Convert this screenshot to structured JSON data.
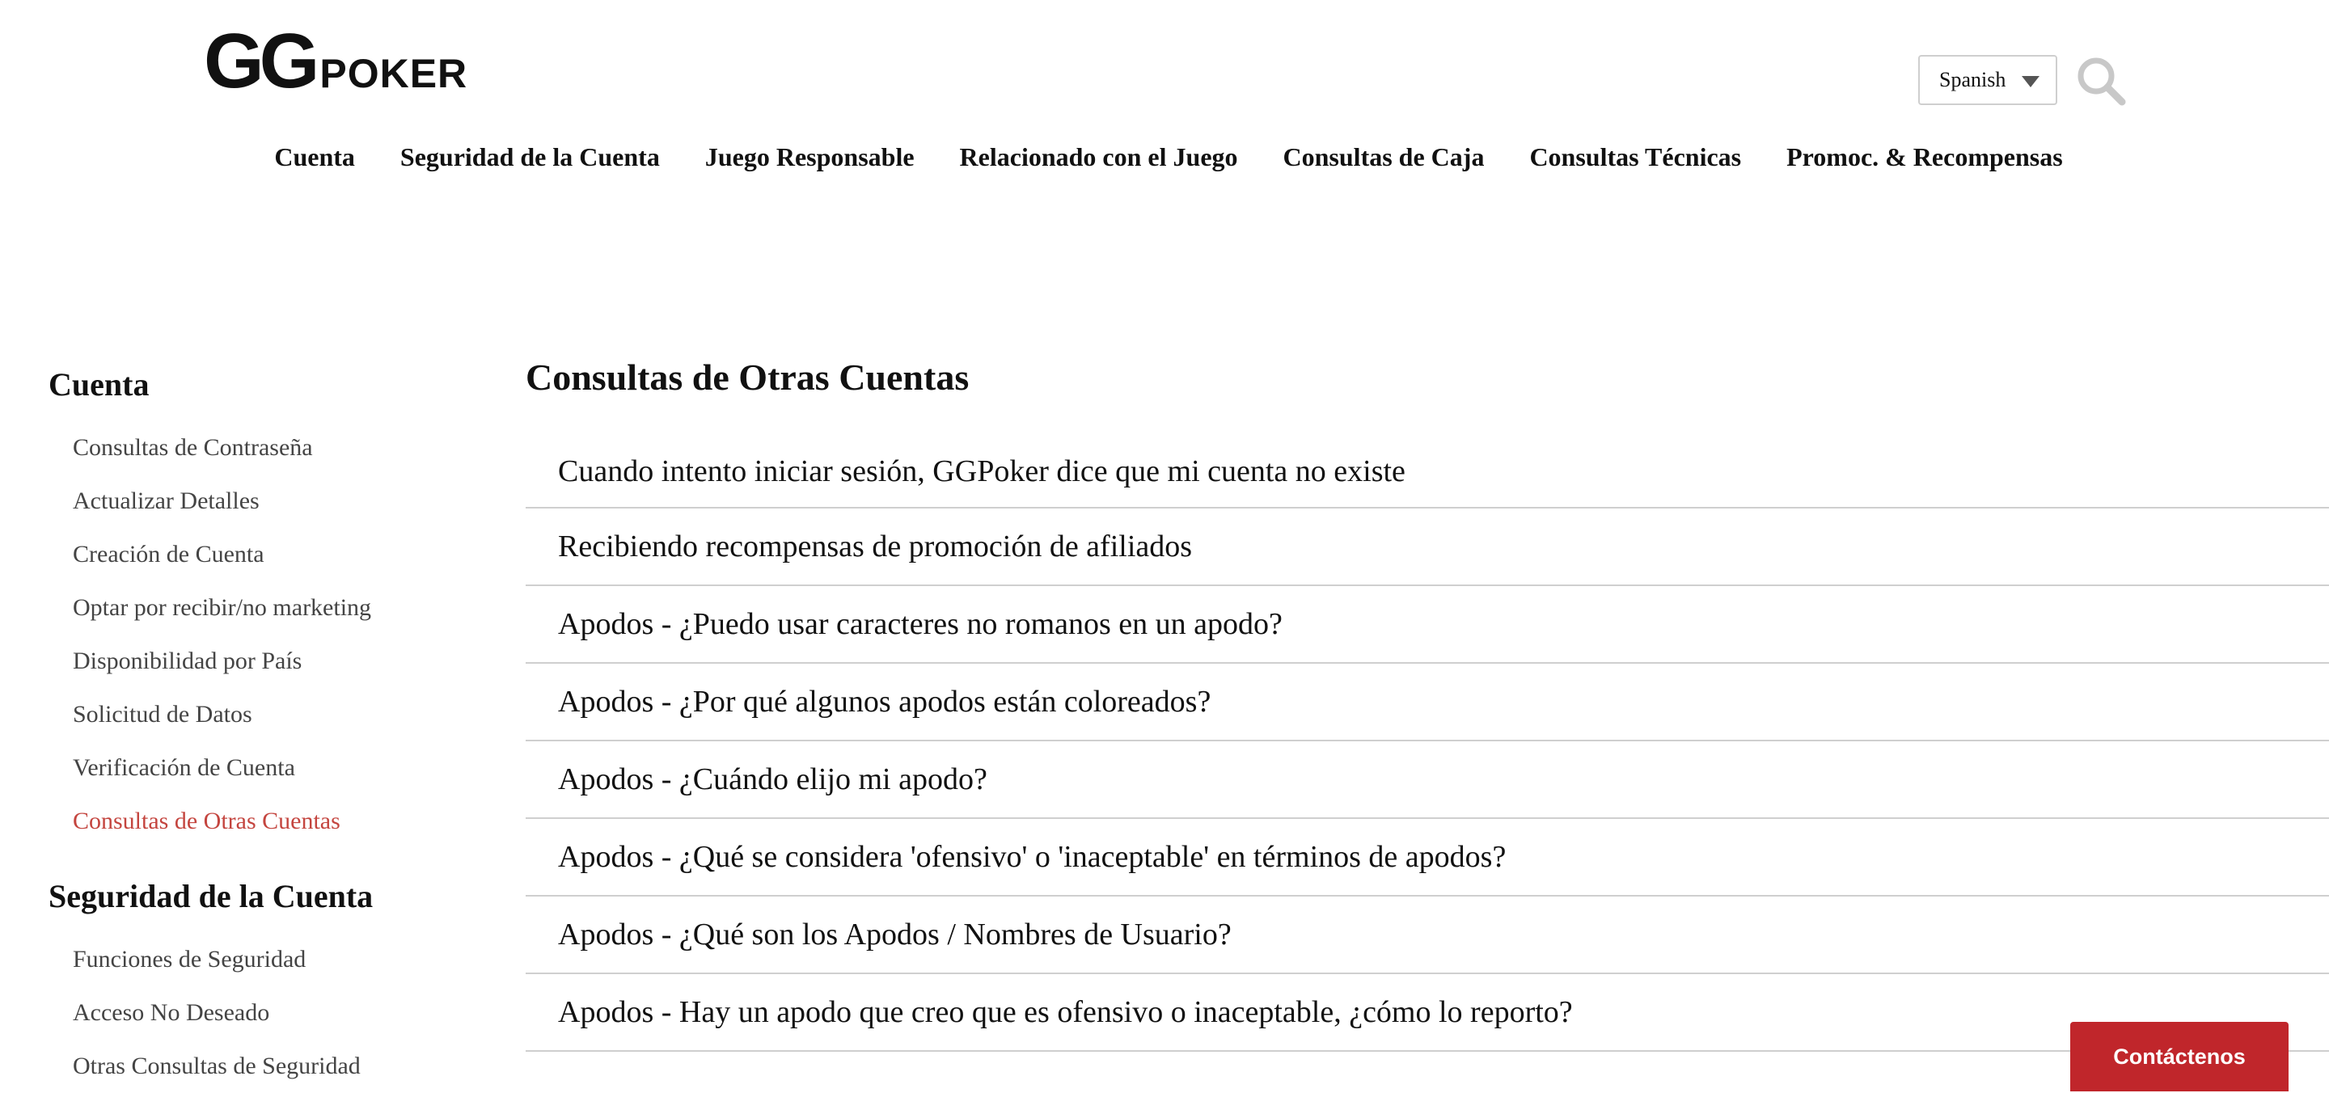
{
  "header": {
    "logo": {
      "mark": "GG",
      "wordmark": "POKER"
    },
    "language": {
      "selected": "Spanish"
    },
    "icons": {
      "search": "search-icon",
      "dropdown": "chevron-down-icon"
    },
    "colors": {
      "brand_red": "#c4262b",
      "active_link": "#c4453f",
      "contact_bg": "#c0262b"
    }
  },
  "nav": {
    "items": [
      {
        "label": "Cuenta"
      },
      {
        "label": "Seguridad de la Cuenta"
      },
      {
        "label": "Juego Responsable"
      },
      {
        "label": "Relacionado con el Juego"
      },
      {
        "label": "Consultas de Caja"
      },
      {
        "label": "Consultas Técnicas"
      },
      {
        "label": "Promoc. & Recompensas"
      }
    ]
  },
  "sidebar": {
    "sections": [
      {
        "title": "Cuenta",
        "items": [
          {
            "label": "Consultas de Contraseña"
          },
          {
            "label": "Actualizar Detalles"
          },
          {
            "label": "Creación de Cuenta"
          },
          {
            "label": "Optar por recibir/no marketing"
          },
          {
            "label": "Disponibilidad por País"
          },
          {
            "label": "Solicitud de Datos"
          },
          {
            "label": "Verificación de Cuenta"
          },
          {
            "label": "Consultas de Otras Cuentas"
          }
        ]
      },
      {
        "title": "Seguridad de la Cuenta",
        "items": [
          {
            "label": "Funciones de Seguridad"
          },
          {
            "label": "Acceso No Deseado"
          },
          {
            "label": "Otras Consultas de Seguridad"
          }
        ]
      }
    ]
  },
  "main": {
    "title": "Consultas de Otras Cuentas",
    "articles": [
      {
        "title": "Cuando intento iniciar sesión, GGPoker dice que mi cuenta no existe"
      },
      {
        "title": "Recibiendo recompensas de promoción de afiliados"
      },
      {
        "title": "Apodos - ¿Puedo usar caracteres no romanos en un apodo?"
      },
      {
        "title": "Apodos - ¿Por qué algunos apodos están coloreados?"
      },
      {
        "title": "Apodos - ¿Cuándo elijo mi apodo?"
      },
      {
        "title": "Apodos - ¿Qué se considera 'ofensivo' o 'inaceptable' en términos de apodos?"
      },
      {
        "title": "Apodos - ¿Qué son los Apodos / Nombres de Usuario?"
      },
      {
        "title": "Apodos - Hay un apodo que creo que es ofensivo o inaceptable, ¿cómo lo reporto?"
      }
    ]
  },
  "contact": {
    "label": "Contáctenos"
  }
}
